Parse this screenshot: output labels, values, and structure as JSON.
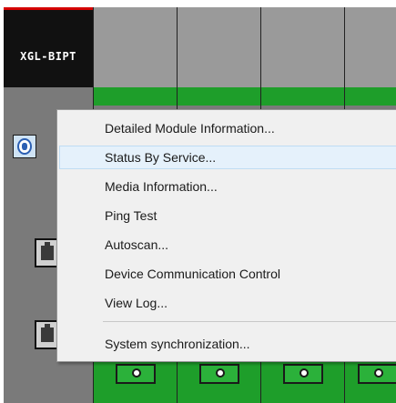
{
  "rack": {
    "cpu_label": "XGL-BIPT",
    "colors": {
      "cpu_header": "#111111",
      "slot_green": "#1e9e2a",
      "rack_gray": "#7a7a7a",
      "accent_red": "#d40000"
    },
    "icons": {
      "status": "status-icon",
      "ethernet": "ethernet-port-icon",
      "slot_port": "slot-port-icon"
    }
  },
  "context_menu": {
    "items": [
      {
        "label": "Detailed Module Information..."
      },
      {
        "label": "Status By Service..."
      },
      {
        "label": "Media Information..."
      },
      {
        "label": "Ping Test"
      },
      {
        "label": "Autoscan..."
      },
      {
        "label": "Device Communication Control"
      },
      {
        "label": "View Log..."
      },
      {
        "label": "System synchronization..."
      }
    ],
    "hover_color": "#e5f1fb"
  }
}
